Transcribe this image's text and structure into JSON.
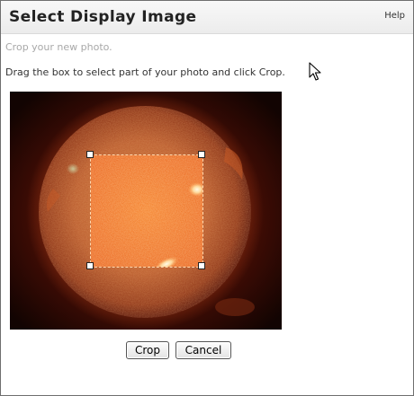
{
  "dialog": {
    "title": "Select Display Image",
    "help_label": "Help"
  },
  "content": {
    "subtitle": "Crop your new photo.",
    "instructions": "Drag the box to select part of your photo and click Crop."
  },
  "buttons": {
    "crop_label": "Crop",
    "cancel_label": "Cancel"
  },
  "colors": {
    "sun_core": "#d8732c",
    "sun_edge": "#6e1508",
    "space": "#180603",
    "crop_area": "#f06a1c",
    "flare": "#fff3c8"
  }
}
